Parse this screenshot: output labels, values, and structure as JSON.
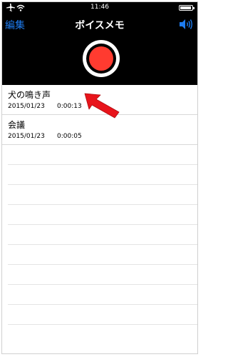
{
  "status_bar": {
    "time": "11:46"
  },
  "nav": {
    "left_label": "編集",
    "title": "ボイスメモ"
  },
  "recordings": [
    {
      "title": "犬の鳴き声",
      "date": "2015/01/23",
      "duration": "0:00:13"
    },
    {
      "title": "会議",
      "date": "2015/01/23",
      "duration": "0:00:05"
    }
  ],
  "colors": {
    "accent": "#1e7cf0",
    "record": "#ff3b30",
    "annotation_arrow": "#e8141b",
    "header_bg": "#000000"
  },
  "icons": [
    "airplane-icon",
    "wifi-icon",
    "battery-icon",
    "speaker-icon",
    "record-icon",
    "arrow-annotation-icon"
  ]
}
